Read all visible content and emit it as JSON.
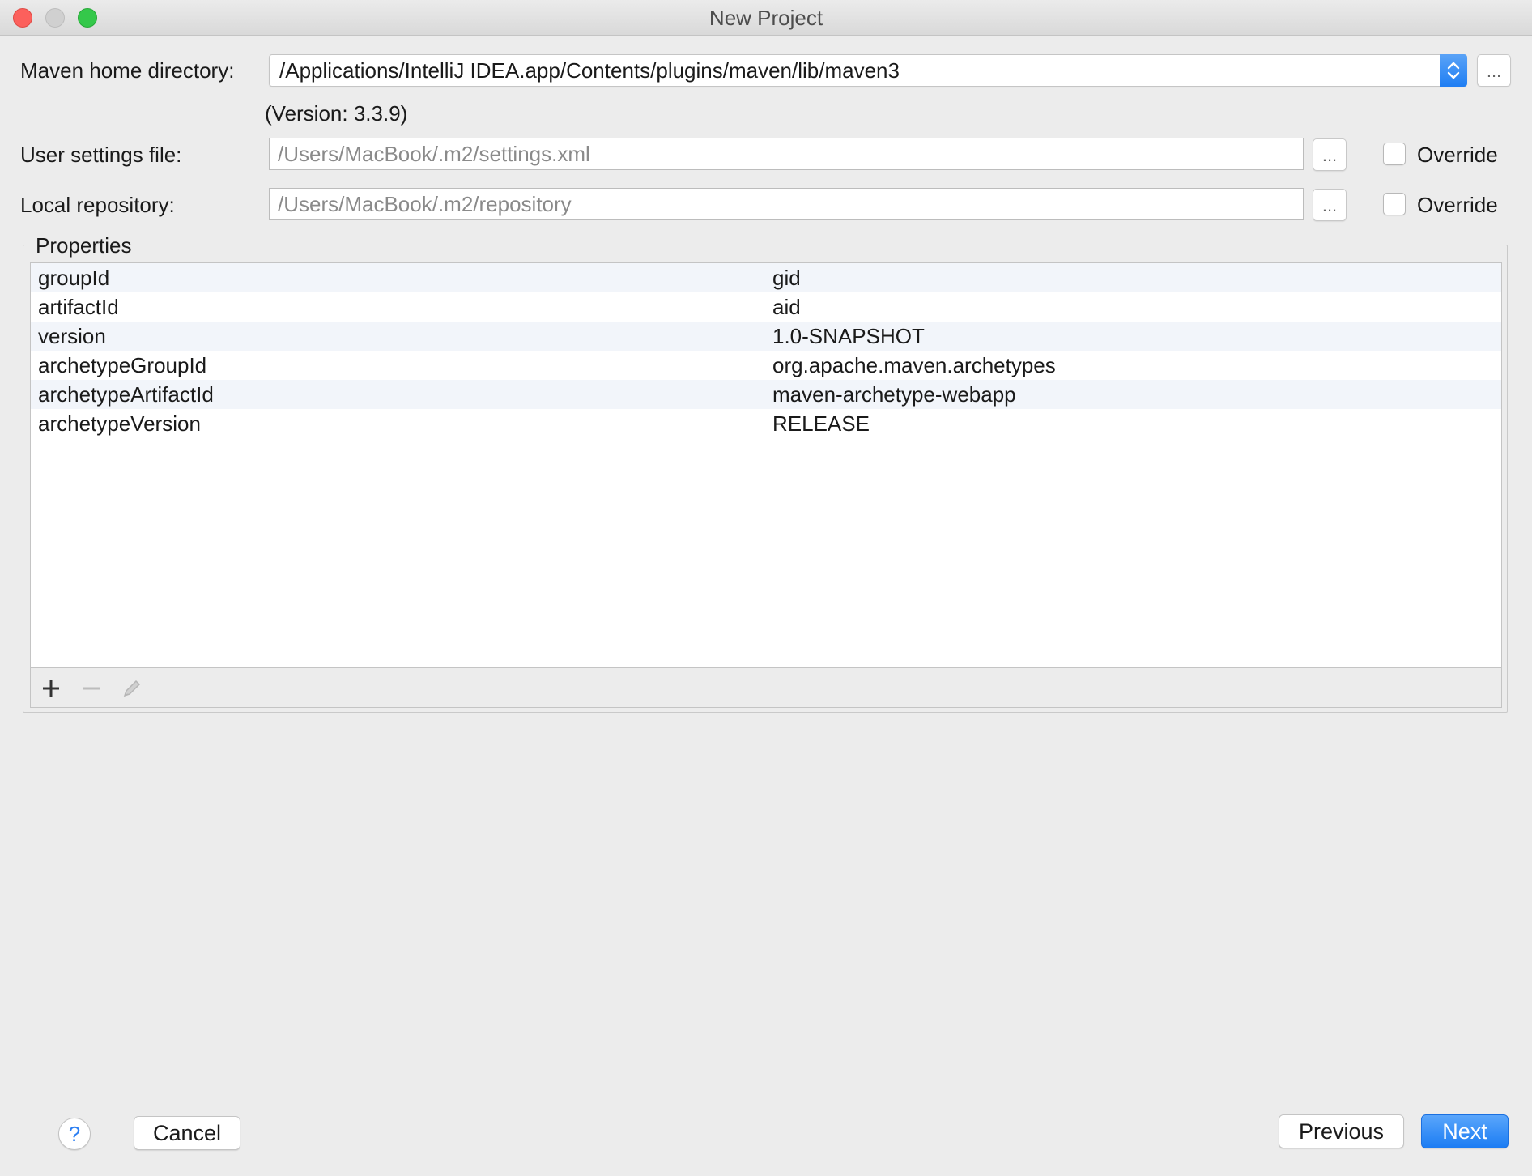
{
  "window": {
    "title": "New Project"
  },
  "form": {
    "maven_home_label": "Maven home directory:",
    "maven_home_value": "/Applications/IntelliJ IDEA.app/Contents/plugins/maven/lib/maven3",
    "version_text": "(Version: 3.3.9)",
    "user_settings_label": "User settings file:",
    "user_settings_placeholder": "/Users/MacBook/.m2/settings.xml",
    "local_repo_label": "Local repository:",
    "local_repo_placeholder": "/Users/MacBook/.m2/repository",
    "browse_label": "...",
    "override_label": "Override"
  },
  "properties": {
    "title": "Properties",
    "rows": [
      {
        "key": "groupId",
        "value": "gid"
      },
      {
        "key": "artifactId",
        "value": "aid"
      },
      {
        "key": "version",
        "value": "1.0-SNAPSHOT"
      },
      {
        "key": "archetypeGroupId",
        "value": "org.apache.maven.archetypes"
      },
      {
        "key": "archetypeArtifactId",
        "value": "maven-archetype-webapp"
      },
      {
        "key": "archetypeVersion",
        "value": "RELEASE"
      }
    ],
    "toolbar_icons": [
      "plus-icon",
      "minus-icon",
      "pencil-icon"
    ]
  },
  "buttons": {
    "help": "?",
    "cancel": "Cancel",
    "previous": "Previous",
    "next": "Next"
  },
  "colors": {
    "accent": "#1b7cf3",
    "window_bg": "#ececec",
    "close": "#fc605c",
    "zoom": "#34c84a"
  }
}
